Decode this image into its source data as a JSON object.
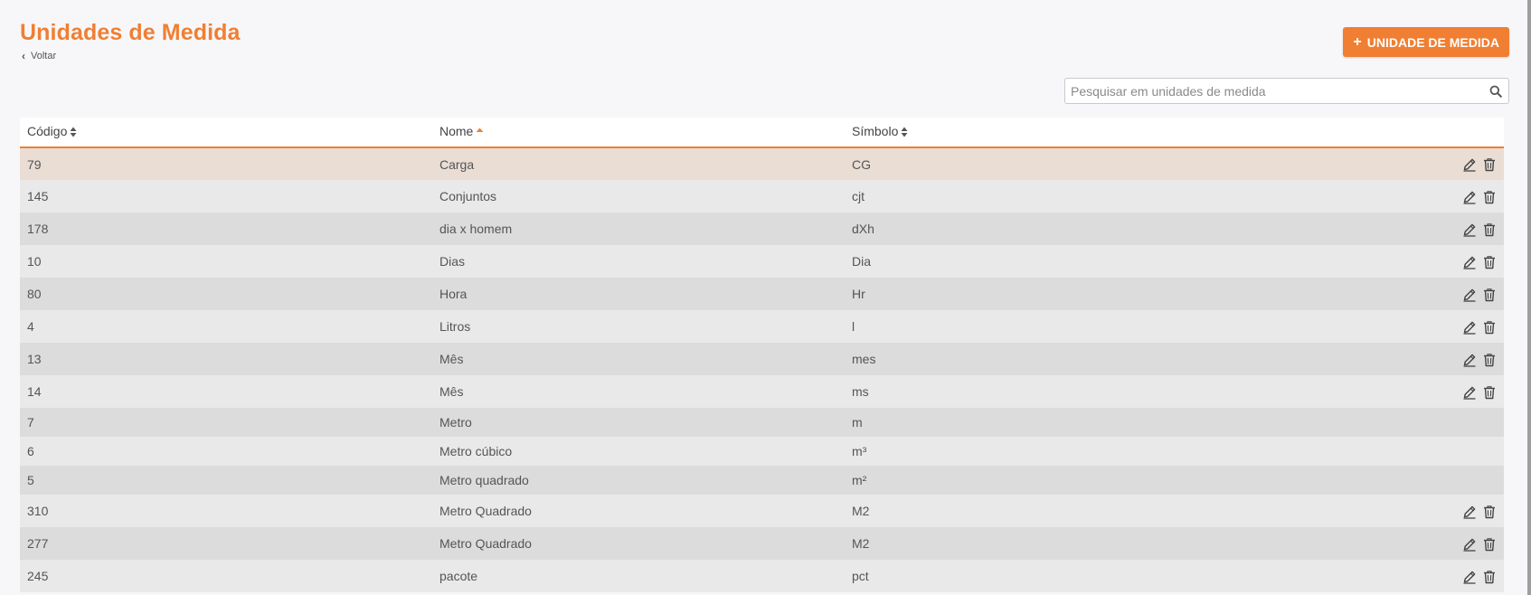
{
  "header": {
    "title": "Unidades de Medida",
    "back_label": "Voltar",
    "add_button_label": "UNIDADE DE MEDIDA"
  },
  "search": {
    "placeholder": "Pesquisar em unidades de medida",
    "value": ""
  },
  "table": {
    "columns": [
      {
        "label": "Código",
        "sort": "both"
      },
      {
        "label": "Nome",
        "sort": "asc"
      },
      {
        "label": "Símbolo",
        "sort": "both"
      }
    ],
    "rows": [
      {
        "codigo": "79",
        "nome": "Carga",
        "simbolo": "CG",
        "actions": true,
        "highlighted": true
      },
      {
        "codigo": "145",
        "nome": "Conjuntos",
        "simbolo": "cjt",
        "actions": true
      },
      {
        "codigo": "178",
        "nome": "dia x homem",
        "simbolo": "dXh",
        "actions": true
      },
      {
        "codigo": "10",
        "nome": "Dias",
        "simbolo": "Dia",
        "actions": true
      },
      {
        "codigo": "80",
        "nome": "Hora",
        "simbolo": "Hr",
        "actions": true
      },
      {
        "codigo": "4",
        "nome": "Litros",
        "simbolo": "l",
        "actions": true
      },
      {
        "codigo": "13",
        "nome": "Mês",
        "simbolo": "mes",
        "actions": true
      },
      {
        "codigo": "14",
        "nome": "Mês",
        "simbolo": "ms",
        "actions": true
      },
      {
        "codigo": "7",
        "nome": "Metro",
        "simbolo": "m",
        "actions": false
      },
      {
        "codigo": "6",
        "nome": "Metro cúbico",
        "simbolo": "m³",
        "actions": false
      },
      {
        "codigo": "5",
        "nome": "Metro quadrado",
        "simbolo": "m²",
        "actions": false
      },
      {
        "codigo": "310",
        "nome": "Metro Quadrado",
        "simbolo": "M2",
        "actions": true
      },
      {
        "codigo": "277",
        "nome": "Metro Quadrado",
        "simbolo": "M2",
        "actions": true
      },
      {
        "codigo": "245",
        "nome": "pacote",
        "simbolo": "pct",
        "actions": true
      }
    ]
  },
  "icons": {
    "back": "chevron-left-icon",
    "add": "plus-icon",
    "search": "search-icon",
    "edit": "pencil-icon",
    "delete": "trash-icon",
    "sort_both": "sort-icon",
    "sort_asc": "sort-up-icon"
  },
  "colors": {
    "accent": "#f07f33",
    "row_highlight": "#e9ddd4",
    "row_odd": "#e9e9e9",
    "row_even": "#dcdcdc"
  }
}
